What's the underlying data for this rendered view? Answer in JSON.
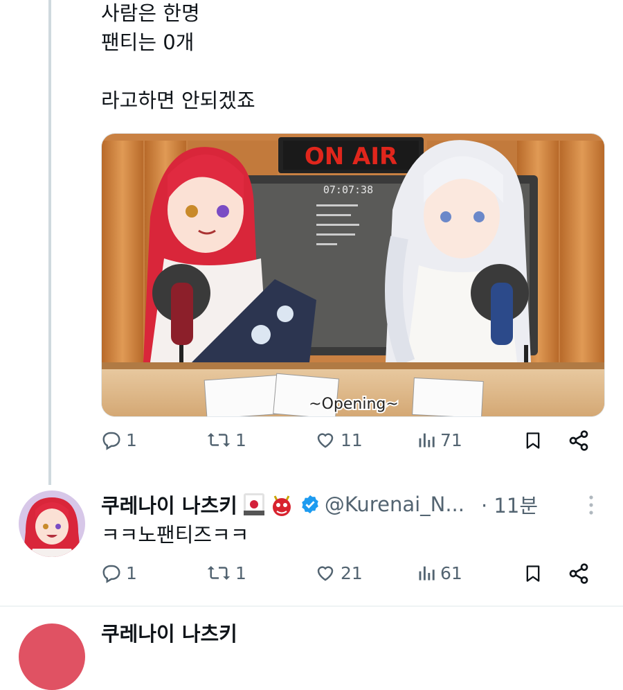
{
  "tweet": {
    "lines": [
      "사람은 한명",
      "팬티는 0개",
      "",
      "라고하면 안되겠죠"
    ],
    "media": {
      "sign": "ON AIR",
      "clock": "07:07:38",
      "caption": "~Opening~"
    },
    "actions": {
      "replies": "1",
      "retweets": "1",
      "likes": "11",
      "views": "71"
    }
  },
  "reply": {
    "display_name": "쿠레나이 나츠키",
    "handle": "@Kurenai_N...",
    "time": "· 11분",
    "text": "ㅋㅋ노팬티즈ㅋㅋ",
    "actions": {
      "replies": "1",
      "retweets": "1",
      "likes": "21",
      "views": "61"
    }
  },
  "next_reply": {
    "display_name": "쿠레나이 나츠키"
  },
  "colors": {
    "text": "#0f1419",
    "muted": "#536471",
    "verified": "#1d9bf0",
    "thread_line": "#cfd9de"
  },
  "icons": [
    "reply-icon",
    "retweet-icon",
    "like-icon",
    "views-icon",
    "bookmark-icon",
    "share-icon",
    "verified-icon",
    "more-icon"
  ]
}
